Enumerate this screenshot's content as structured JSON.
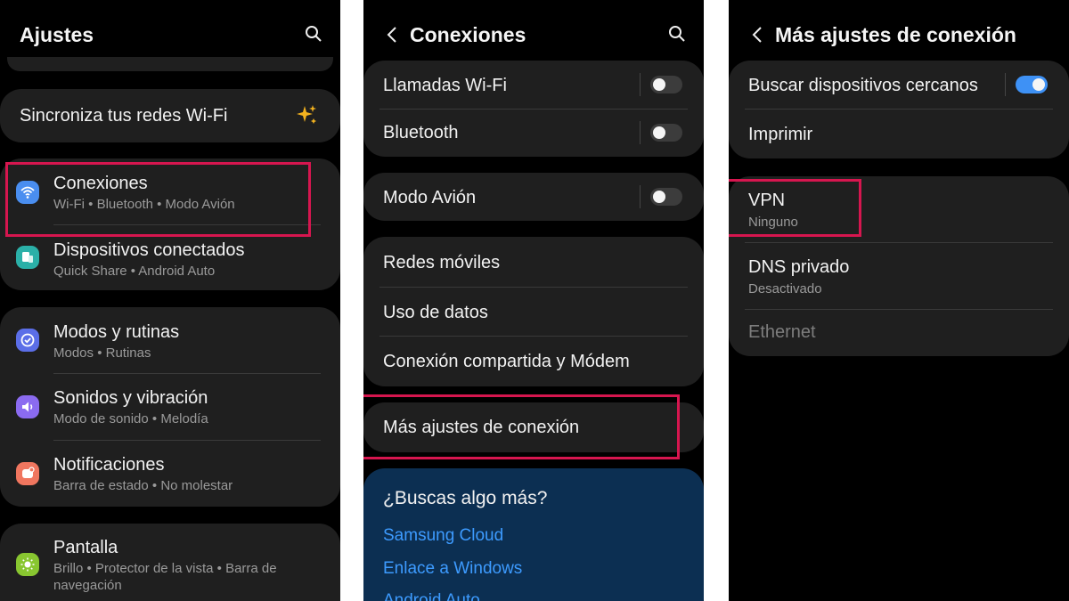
{
  "screens": [
    {
      "title": "Ajustes",
      "wifi_sync": "Sincroniza tus redes Wi-Fi",
      "items": [
        {
          "label": "Conexiones",
          "sub": "Wi-Fi  •  Bluetooth  •  Modo Avión",
          "icon": "wifi-icon",
          "color": "#4a8ef0"
        },
        {
          "label": "Dispositivos conectados",
          "sub": "Quick Share  •  Android Auto",
          "icon": "devices-icon",
          "color": "#2bb0a8"
        },
        {
          "label": "Modos y rutinas",
          "sub": "Modos  •  Rutinas",
          "icon": "check-circle-icon",
          "color": "#5b6ee8"
        },
        {
          "label": "Sonidos y vibración",
          "sub": "Modo de sonido  •  Melodía",
          "icon": "speaker-icon",
          "color": "#8b6bf0"
        },
        {
          "label": "Notificaciones",
          "sub": "Barra de estado  •  No molestar",
          "icon": "bell-icon",
          "color": "#f0765f"
        },
        {
          "label": "Pantalla",
          "sub": "Brillo  •  Protector de la vista  •  Barra de navegación",
          "icon": "sun-icon",
          "color": "#88c630"
        }
      ]
    },
    {
      "title": "Conexiones",
      "toggles": [
        {
          "label": "Llamadas Wi-Fi",
          "on": false
        },
        {
          "label": "Bluetooth",
          "on": false
        },
        {
          "label": "Modo Avión",
          "on": false
        }
      ],
      "items": [
        "Redes móviles",
        "Uso de datos",
        "Conexión compartida y Módem",
        "Más ajustes de conexión"
      ],
      "suggest": {
        "heading": "¿Buscas algo más?",
        "links": [
          "Samsung Cloud",
          "Enlace a Windows",
          "Android Auto"
        ]
      }
    },
    {
      "title": "Más ajustes de conexión",
      "nearby": {
        "label": "Buscar dispositivos cercanos",
        "on": true
      },
      "print": "Imprimir",
      "vpn": {
        "label": "VPN",
        "sub": "Ninguno"
      },
      "dns": {
        "label": "DNS privado",
        "sub": "Desactivado"
      },
      "ethernet": "Ethernet"
    }
  ],
  "colors": {
    "background": "#000000",
    "card": "#1f1f1f",
    "highlight": "#d6164f",
    "accent": "#3e91f5",
    "link": "#3d9bff",
    "suggest_bg": "#0c2f52"
  }
}
